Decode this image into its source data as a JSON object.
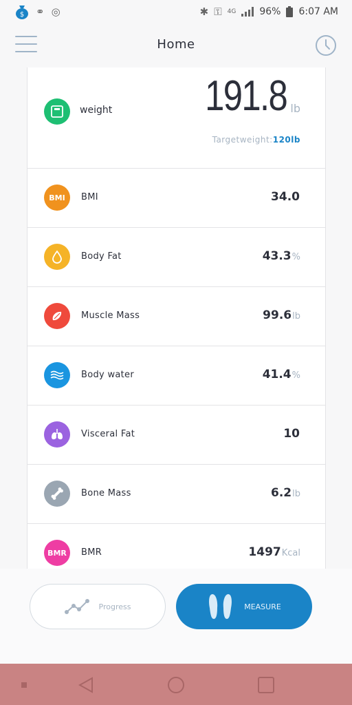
{
  "status_bar": {
    "battery": "96%",
    "time": "6:07 AM",
    "network": "4G"
  },
  "header": {
    "title": "Home"
  },
  "weight": {
    "label": "weight",
    "value": "191.8",
    "unit": "lb",
    "target_label": "Targetweight:",
    "target_value": "120lb",
    "icon": "scale-icon",
    "color": "#1ebf73"
  },
  "metrics": [
    {
      "label": "BMI",
      "value": "34.0",
      "unit": "",
      "icon_text": "BMI",
      "color": "#f0921e"
    },
    {
      "label": "Body Fat",
      "value": "43.3",
      "unit": "%",
      "icon": "droplet-icon",
      "color": "#f5b327"
    },
    {
      "label": "Muscle Mass",
      "value": "99.6",
      "unit": "lb",
      "icon": "muscle-icon",
      "color": "#ef4a3c"
    },
    {
      "label": "Body water",
      "value": "41.4",
      "unit": "%",
      "icon": "waves-icon",
      "color": "#1a95e0"
    },
    {
      "label": "Visceral Fat",
      "value": "10",
      "unit": "",
      "icon": "lungs-icon",
      "color": "#9b63e0"
    },
    {
      "label": "Bone Mass",
      "value": "6.2",
      "unit": "lb",
      "icon": "bone-icon",
      "color": "#9aa6b2"
    },
    {
      "label": "BMR",
      "value": "1497",
      "unit": "Kcal",
      "icon_text": "BMR",
      "color": "#ee3da3"
    }
  ],
  "actions": {
    "progress_label": "Progress",
    "measure_label": "MEASURE",
    "measure_color": "#1a84c7"
  }
}
